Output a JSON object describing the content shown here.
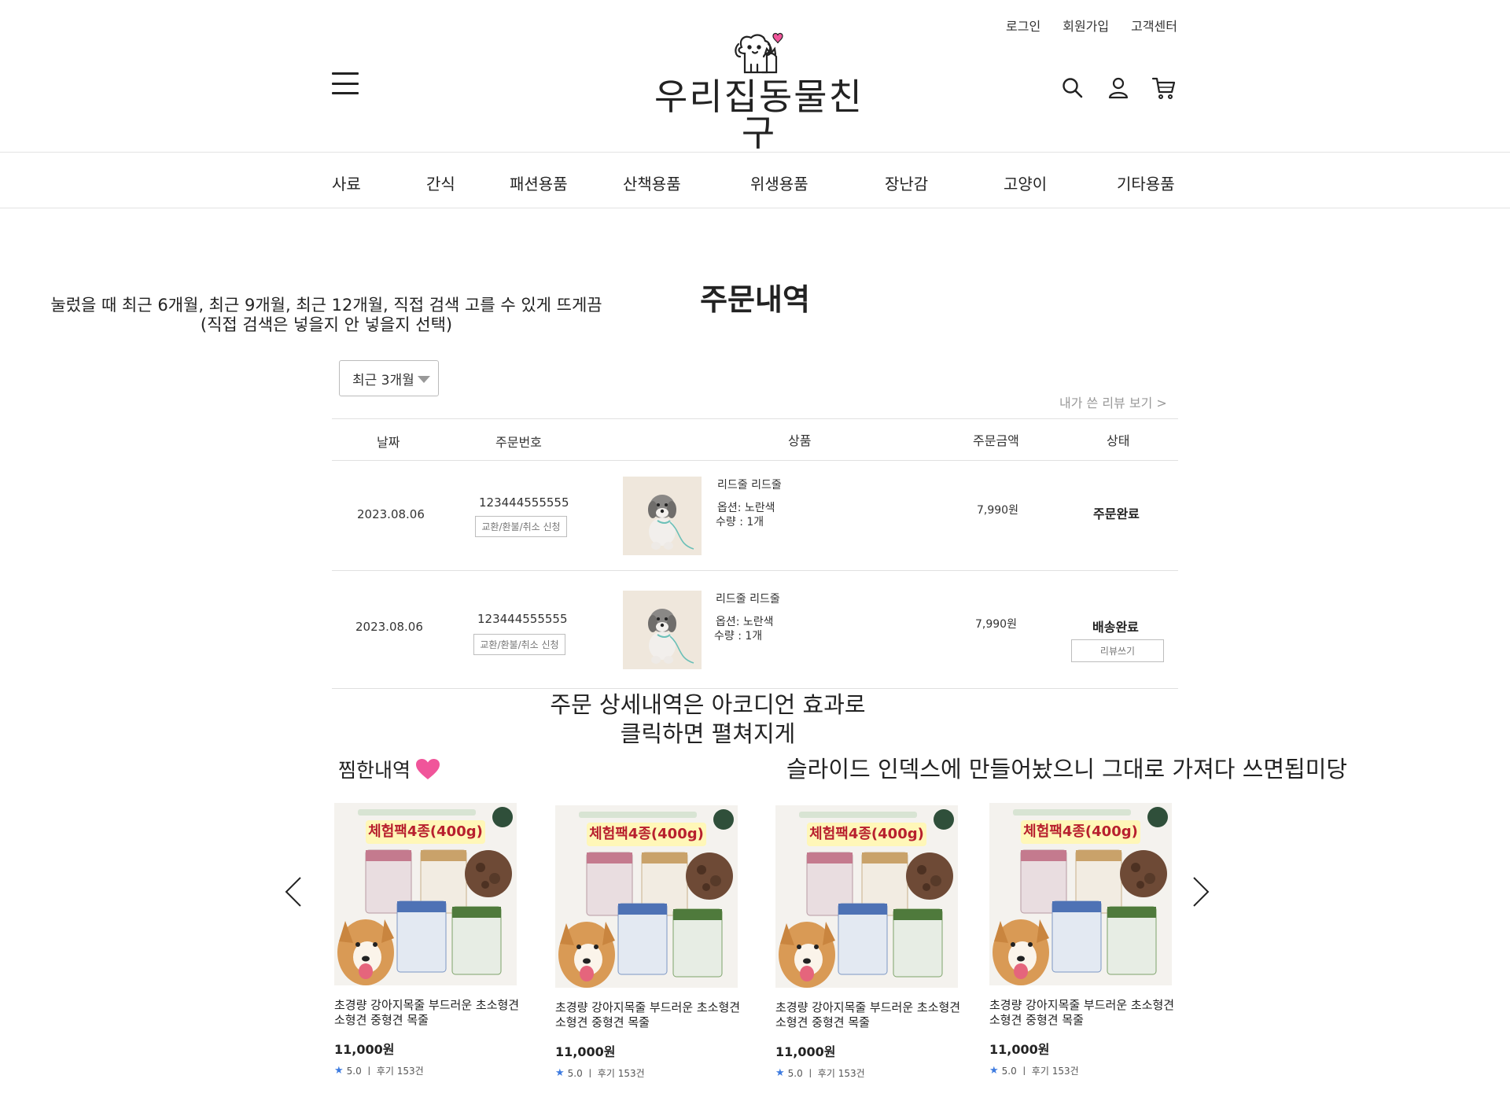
{
  "header": {
    "util_links": [
      "로그인",
      "회원가입",
      "고객센터"
    ],
    "logo_text": "우리집동물친구"
  },
  "nav": {
    "categories": [
      "사료",
      "간식",
      "패션용품",
      "산책용품",
      "위생용품",
      "장난감",
      "고양이",
      "기타용품"
    ]
  },
  "notes": {
    "period_line1": "눌렀을 때 최근 6개월, 최근 9개월, 최근 12개월, 직접 검색 고를 수 있게 뜨게끔",
    "period_line2": "(직접 검색은 넣을지 안 넣을지 선택)",
    "accordion_line1": "주문 상세내역은 아코디언 효과로",
    "accordion_line2": "클릭하면 펼쳐지게",
    "slide": "슬라이드 인덱스에 만들어놨으니 그대로 가져다 쓰면됩미당"
  },
  "main": {
    "title": "주문내역",
    "period_select": "최근 3개월",
    "review_link": "내가 쓴 리뷰 보기 >"
  },
  "order_table": {
    "headers": [
      "날짜",
      "주문번호",
      "상품",
      "주문금액",
      "상태"
    ],
    "rows": [
      {
        "date": "2023.08.06",
        "order_no": "123444555555",
        "action": "교환/환불/취소 신청",
        "product_name": "리드줄 리드줄",
        "option": "옵션: 노란색",
        "qty": "수량 : 1개",
        "amount": "7,990원",
        "status": "주문완료"
      },
      {
        "date": "2023.08.06",
        "order_no": "123444555555",
        "action": "교환/환불/취소 신청",
        "product_name": "리드줄 리드줄",
        "option": "옵션: 노란색",
        "qty": "수량 : 1개",
        "amount": "7,990원",
        "status": "배송완료",
        "review_button": "리뷰쓰기"
      }
    ]
  },
  "wishlist": {
    "title": "찜한내역",
    "items": [
      {
        "name": "초경량 강아지목줄 부드러운 초소형견 소형견 중형견 목줄",
        "price": "11,000원",
        "rating": "5.0",
        "reviews": "후기 153건",
        "banner": "체험팩4종(400g)"
      },
      {
        "name": "초경량 강아지목줄 부드러운 초소형견 소형견 중형견 목줄",
        "price": "11,000원",
        "rating": "5.0",
        "reviews": "후기 153건",
        "banner": "체험팩4종(400g)"
      },
      {
        "name": "초경량 강아지목줄 부드러운 초소형견 소형견 중형견 목줄",
        "price": "11,000원",
        "rating": "5.0",
        "reviews": "후기 153건",
        "banner": "체험팩4종(400g)"
      },
      {
        "name": "초경량 강아지목줄 부드러운 초소형견 소형견 중형견 목줄",
        "price": "11,000원",
        "rating": "5.0",
        "reviews": "후기 153건",
        "banner": "체험팩4종(400g)"
      }
    ]
  },
  "colors": {
    "heart": "#f0559a",
    "star": "#3d7be0",
    "border": "#e0e0e0",
    "muted": "#999999"
  }
}
